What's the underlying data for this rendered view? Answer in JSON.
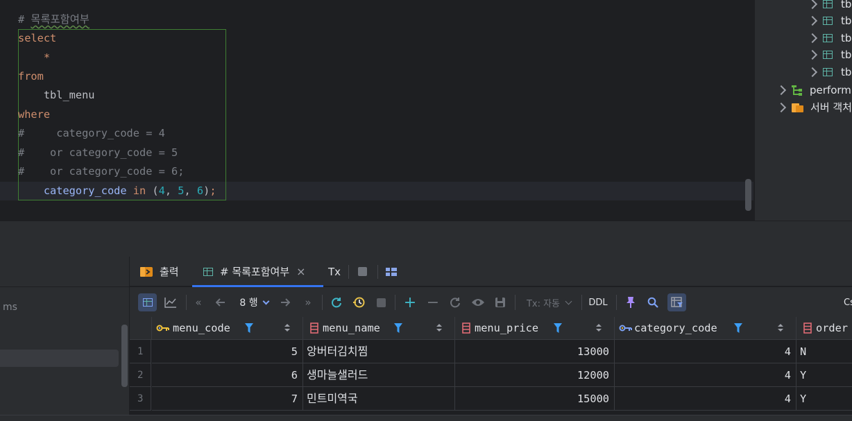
{
  "editor": {
    "comment_title": "목록포함여부",
    "lines": {
      "l1_hash": "# ",
      "l2": "select",
      "l3": "    *",
      "l4": "from",
      "l5": "    tbl_menu",
      "l6": "where",
      "l7": "#     category_code = 4",
      "l8": "#    or category_code = 5",
      "l9": "#    or category_code = 6;",
      "l10_indent": "    ",
      "l10_field": "category_code",
      "l10_in": " in ",
      "l10_open": "(",
      "l10_n1": "4",
      "l10_c1": ", ",
      "l10_n2": "5",
      "l10_c2": ", ",
      "l10_n3": "6",
      "l10_close": ")",
      "l10_semi": ";"
    }
  },
  "tree": {
    "tables": [
      "tb",
      "tb",
      "tb",
      "tb",
      "tb"
    ],
    "schema": "perform",
    "server_objects": "서버 객처"
  },
  "left_panel": {
    "label": "ms"
  },
  "tabs": {
    "output": "출력",
    "result": "# 목록포함여부",
    "tx": "Tx"
  },
  "toolbar": {
    "rows": "8 행",
    "tx_mode": "Tx: 자동",
    "ddl": "DDL",
    "right_label": "Cs"
  },
  "grid": {
    "columns": [
      "menu_code",
      "menu_name",
      "menu_price",
      "category_code",
      "order"
    ],
    "rows": [
      {
        "n": "1",
        "menu_code": "5",
        "menu_name": "앙버터김치찜",
        "menu_price": "13000",
        "category_code": "4",
        "order": "N"
      },
      {
        "n": "2",
        "menu_code": "6",
        "menu_name": "생마늘샐러드",
        "menu_price": "12000",
        "category_code": "4",
        "order": "Y"
      },
      {
        "n": "3",
        "menu_code": "7",
        "menu_name": "민트미역국",
        "menu_price": "15000",
        "category_code": "4",
        "order": "Y"
      }
    ]
  },
  "colors": {
    "accent": "#3574f0",
    "keyword": "#cf8e6d",
    "number": "#2aacb8",
    "comment": "#7a7e85",
    "field": "#c77dbb",
    "filter": "#3d9ef5",
    "key_icon": "#f0c33c",
    "column_icon": "#e06c75"
  }
}
